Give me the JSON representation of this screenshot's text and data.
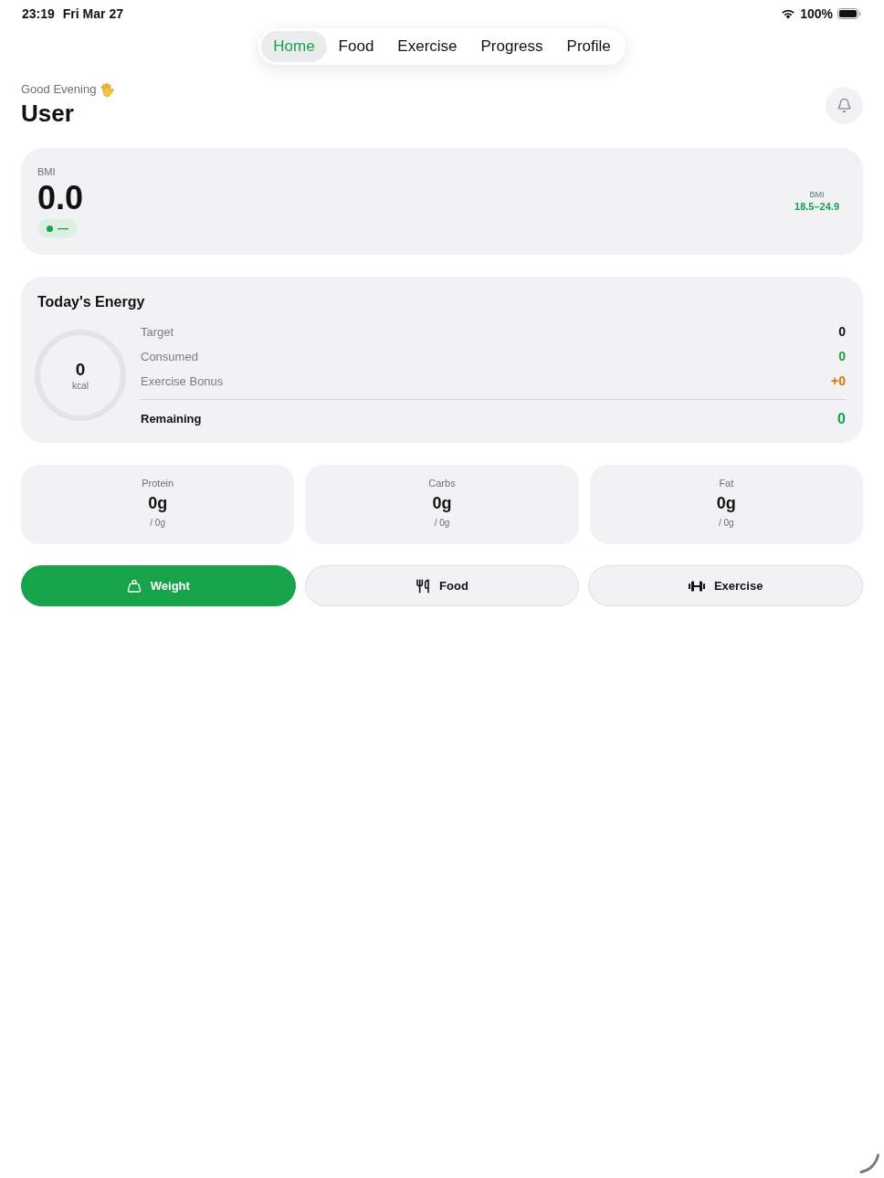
{
  "status_bar": {
    "time": "23:19",
    "date": "Fri Mar 27",
    "battery": "100%"
  },
  "tabs": [
    {
      "label": "Home",
      "selected": true
    },
    {
      "label": "Food",
      "selected": false
    },
    {
      "label": "Exercise",
      "selected": false
    },
    {
      "label": "Progress",
      "selected": false
    },
    {
      "label": "Profile",
      "selected": false
    }
  ],
  "header": {
    "greeting": "Good Evening",
    "name": "User"
  },
  "bmi": {
    "label": "BMI",
    "value": "0.0",
    "status": {
      "text": "—",
      "color": "#16a34a"
    },
    "range_label": "BMI",
    "range": "18.5–24.9"
  },
  "energy": {
    "title": "Today's Energy",
    "ring": {
      "value": "0",
      "unit": "kcal"
    },
    "rows": [
      {
        "label": "Target",
        "value": "0",
        "color": "#111111"
      },
      {
        "label": "Consumed",
        "value": "0",
        "color": "#16a34a"
      },
      {
        "label": "Exercise Bonus",
        "value": "+0",
        "color": "#d97706"
      }
    ],
    "total": {
      "label": "Remaining",
      "value": "0"
    }
  },
  "macros": [
    {
      "label": "Protein",
      "value": "0g",
      "goal": "/ 0g"
    },
    {
      "label": "Carbs",
      "value": "0g",
      "goal": "/ 0g"
    },
    {
      "label": "Fat",
      "value": "0g",
      "goal": "/ 0g"
    }
  ],
  "actions": [
    {
      "label": "Weight",
      "kind": "primary"
    },
    {
      "label": "Food",
      "kind": "secondary"
    },
    {
      "label": "Exercise",
      "kind": "secondary"
    }
  ]
}
